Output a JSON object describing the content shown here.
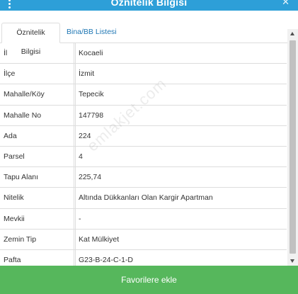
{
  "header": {
    "title": "Öznitelik Bilgisi",
    "menu_icon": "kebab-menu-icon",
    "close_icon": "close-icon",
    "close_glyph": "✕"
  },
  "tabs": [
    {
      "label": "Öznitelik Bilgisi",
      "active": true
    },
    {
      "label": "Bina/BB Listesi",
      "active": false
    }
  ],
  "attributes": [
    {
      "key": "İl",
      "value": "Kocaeli"
    },
    {
      "key": "İlçe",
      "value": "İzmit"
    },
    {
      "key": "Mahalle/Köy",
      "value": "Tepecik"
    },
    {
      "key": "Mahalle No",
      "value": "147798"
    },
    {
      "key": "Ada",
      "value": "224"
    },
    {
      "key": "Parsel",
      "value": "4"
    },
    {
      "key": "Tapu Alanı",
      "value": "225,74"
    },
    {
      "key": "Nitelik",
      "value": "Altında Dükkanları Olan Kargir Apartman"
    },
    {
      "key": "Mevkii",
      "value": "-"
    },
    {
      "key": "Zemin Tip",
      "value": "Kat Mülkiyet"
    },
    {
      "key": "Pafta",
      "value": "G23-B-24-C-1-D"
    }
  ],
  "watermark": "emlakjet.com",
  "footer": {
    "button_label": "Favorilere ekle"
  },
  "colors": {
    "header_bg": "#2d9fd8",
    "tab_link": "#1f77b4",
    "button_bg": "#56b75c"
  }
}
